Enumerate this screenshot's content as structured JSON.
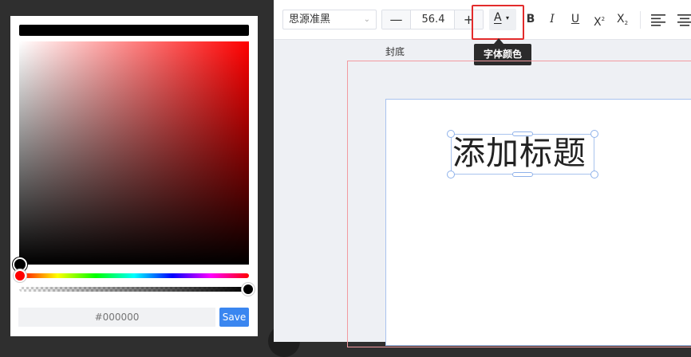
{
  "color_picker": {
    "hex_value": "",
    "hex_placeholder": "#000000",
    "save_label": "Save",
    "current_color": "#000000",
    "hue_color": "#ff0000",
    "alpha_percent": 100
  },
  "toolbar": {
    "font_family": "思源准黑",
    "font_size": "56.4",
    "minus_label": "—",
    "plus_label": "+",
    "font_color_letter": "A",
    "font_color_caret": "▾",
    "bold_label": "B",
    "italic_label": "I",
    "underline_label": "U",
    "superscript_label": "X",
    "superscript_mark": "2",
    "subscript_label": "X",
    "subscript_mark": "2",
    "highlight_color": "#e32b2b"
  },
  "tooltip": {
    "text": "字体颜色"
  },
  "canvas": {
    "page_label": "封底",
    "title_text": "添加标题"
  },
  "colors": {
    "accent": "#3a86f0",
    "selection": "#8fb2ea",
    "bleed": "#f29aa0"
  }
}
